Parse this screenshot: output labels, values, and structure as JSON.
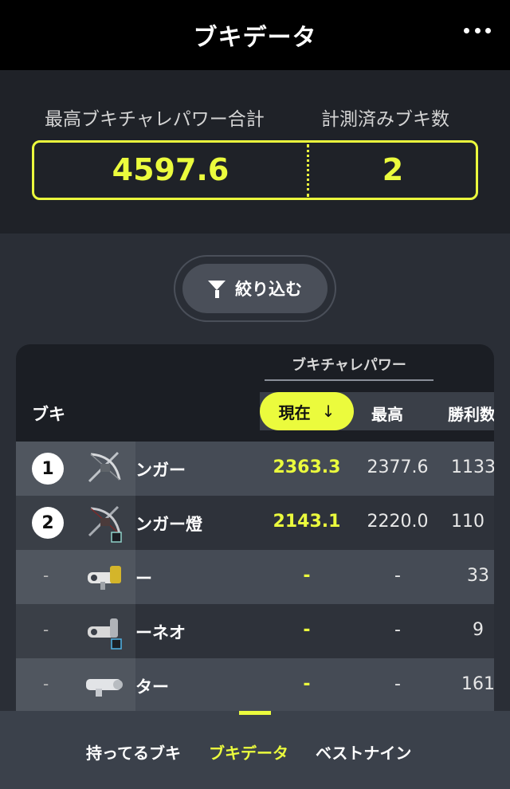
{
  "header": {
    "title": "ブキデータ"
  },
  "summary": {
    "label_total": "最高ブキチャレパワー合計",
    "label_count": "計測済みブキ数",
    "total": "4597.6",
    "count": "2"
  },
  "filter": {
    "label": "絞り込む"
  },
  "table": {
    "group_label": "ブキチャレパワー",
    "col_weapon": "ブキ",
    "col_current": "現在",
    "col_max": "最高",
    "col_wins": "勝利数",
    "rows": [
      {
        "rank": "1",
        "name": "ンガー",
        "current": "2363.3",
        "max": "2377.6",
        "wins": "1133"
      },
      {
        "rank": "2",
        "name": "ンガー燈",
        "current": "2143.1",
        "max": "2220.0",
        "wins": "110"
      },
      {
        "rank": "-",
        "name": "ー",
        "current": "-",
        "max": "-",
        "wins": "33"
      },
      {
        "rank": "-",
        "name": "ーネオ",
        "current": "-",
        "max": "-",
        "wins": "9"
      },
      {
        "rank": "-",
        "name": "ター",
        "current": "-",
        "max": "-",
        "wins": "161"
      }
    ]
  },
  "nav": {
    "items": [
      "持ってるブキ",
      "ブキデータ",
      "ベストナイン"
    ],
    "active": "ブキデータ"
  },
  "colors": {
    "accent": "#ebfb3d",
    "header_bg": "#000000",
    "panel_bg": "#1f2228"
  }
}
